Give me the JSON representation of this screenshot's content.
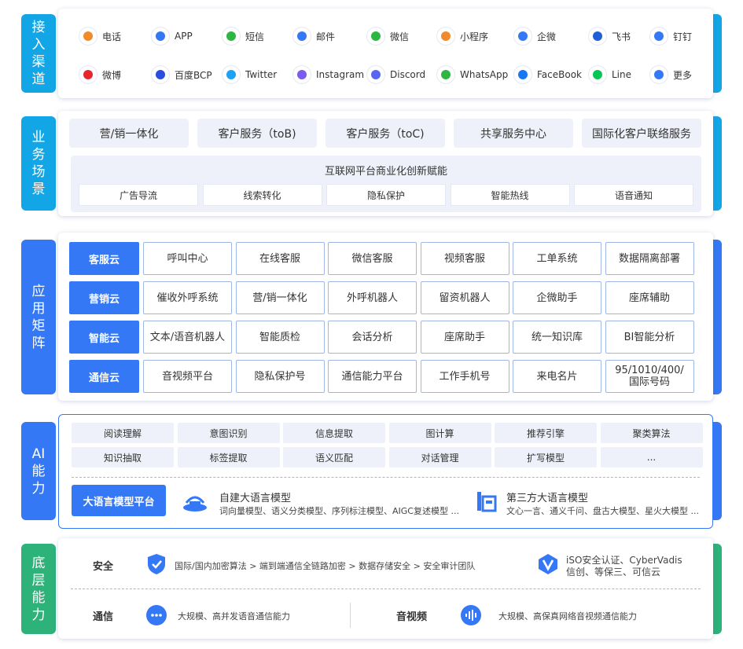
{
  "layers": {
    "channel": "接入渠道",
    "scenario": "业务场景",
    "app": "应用矩阵",
    "ai": "AI能力",
    "base": "底层能力"
  },
  "channels": [
    {
      "label": "电话",
      "icon": "phone-icon",
      "color": "#f08a2a"
    },
    {
      "label": "APP",
      "icon": "app-store-icon",
      "color": "#3478f6"
    },
    {
      "label": "短信",
      "icon": "sms-icon",
      "color": "#2db742"
    },
    {
      "label": "邮件",
      "icon": "mail-icon",
      "color": "#3478f6"
    },
    {
      "label": "微信",
      "icon": "wechat-icon",
      "color": "#2db742"
    },
    {
      "label": "小程序",
      "icon": "mini-program-icon",
      "color": "#f08a2a"
    },
    {
      "label": "企微",
      "icon": "wecom-icon",
      "color": "#3478f6"
    },
    {
      "label": "飞书",
      "icon": "feishu-icon",
      "color": "#1f5fd6"
    },
    {
      "label": "钉钉",
      "icon": "dingtalk-icon",
      "color": "#3478f6"
    },
    {
      "label": "微博",
      "icon": "weibo-icon",
      "color": "#e6262e"
    },
    {
      "label": "百度BCP",
      "icon": "baidu-icon",
      "color": "#2a4fe0"
    },
    {
      "label": "Twitter",
      "icon": "twitter-icon",
      "color": "#1da1f2"
    },
    {
      "label": "Instagram",
      "icon": "instagram-icon",
      "color": "#7b5cf0"
    },
    {
      "label": "Discord",
      "icon": "discord-icon",
      "color": "#5865f2"
    },
    {
      "label": "WhatsApp",
      "icon": "whatsapp-icon",
      "color": "#2db742"
    },
    {
      "label": "FaceBook",
      "icon": "facebook-icon",
      "color": "#1877f2"
    },
    {
      "label": "Line",
      "icon": "line-icon",
      "color": "#06c755"
    },
    {
      "label": "更多",
      "icon": "more-icon",
      "color": "#3478f6"
    }
  ],
  "scenario": {
    "top": [
      "营/销一体化",
      "客户服务（toB)",
      "客户服务（toC)",
      "共享服务中心",
      "国际化客户联络服务"
    ],
    "platform_title": "互联网平台商业化创新赋能",
    "sub": [
      "广告导流",
      "线索转化",
      "隐私保护",
      "智能热线",
      "语音通知"
    ]
  },
  "matrix": [
    {
      "cloud": "客服云",
      "items": [
        "呼叫中心",
        "在线客服",
        "微信客服",
        "视频客服",
        "工单系统",
        "数据隔离部署"
      ]
    },
    {
      "cloud": "营销云",
      "items": [
        "催收外呼系统",
        "营/销一体化",
        "外呼机器人",
        "留资机器人",
        "企微助手",
        "座席辅助"
      ]
    },
    {
      "cloud": "智能云",
      "items": [
        "文本/语音机器人",
        "智能质检",
        "会话分析",
        "座席助手",
        "统一知识库",
        "BI智能分析"
      ]
    },
    {
      "cloud": "通信云",
      "items": [
        "音视频平台",
        "隐私保护号",
        "通信能力平台",
        "工作手机号",
        "来电名片",
        "95/1010/400/\n国际号码"
      ]
    }
  ],
  "ai": {
    "row1": [
      "阅读理解",
      "意图识别",
      "信息提取",
      "图计算",
      "推荐引擎",
      "聚类算法"
    ],
    "row2": [
      "知识抽取",
      "标签提取",
      "语义匹配",
      "对话管理",
      "扩写模型",
      "..."
    ],
    "llm_platform": "大语言模型平台",
    "self": {
      "title": "自建大语言模型",
      "desc": "词向量模型、语义分类模型、序列标注模型、AIGC复述模型 ..."
    },
    "third": {
      "title": "第三方大语言模型",
      "desc": "文心一言、通义千问、盘古大模型、星火大模型 ..."
    }
  },
  "base": {
    "security_label": "安全",
    "security_desc": "国际/国内加密算法 > 端到端通信全链路加密 > 数据存储安全 > 安全审计团队",
    "cert_line1": "iSO安全认证、CyberVadis",
    "cert_line2": "信创、等保三、可信云",
    "comm_label": "通信",
    "comm_desc": "大规模、高并发语音通信能力",
    "av_label": "音视频",
    "av_desc": "大规模、高保真网络音视频通信能力"
  },
  "colors": {
    "channel_tab": "#12a6e6",
    "scenario_tab": "#12a6e6",
    "app_tab": "#3478f6",
    "ai_tab": "#3478f6",
    "base_tab": "#2db27a",
    "primary": "#3478f6"
  }
}
